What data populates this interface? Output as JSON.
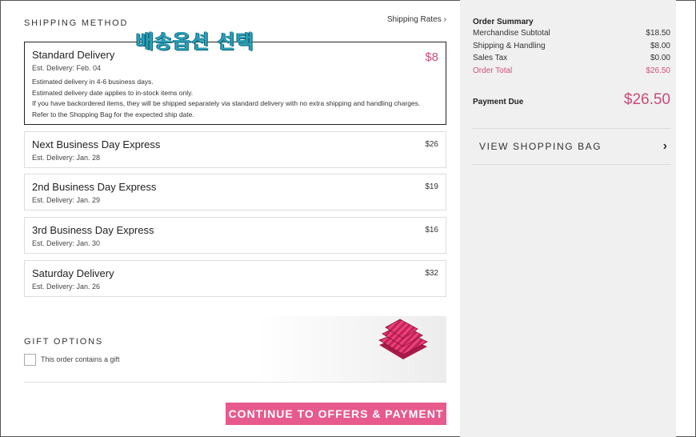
{
  "shipping": {
    "heading": "SHIPPING METHOD",
    "rates_link": "Shipping Rates",
    "overlay_korean": "배송옵션 선택",
    "options": [
      {
        "title": "Standard Delivery",
        "est": "Est. Delivery: Feb. 04",
        "price": "$8",
        "selected": true,
        "notes": [
          "Estimated delivery in 4-6 business days.",
          "Estimated delivery date applies to in-stock items only.",
          "If you have backordered items, they will be shipped separately via standard delivery with no extra shipping and handling charges. Refer to the Shopping Bag for the expected ship date."
        ]
      },
      {
        "title": "Next Business Day Express",
        "est": "Est. Delivery: Jan. 28",
        "price": "$26"
      },
      {
        "title": "2nd Business Day Express",
        "est": "Est. Delivery: Jan. 29",
        "price": "$19"
      },
      {
        "title": "3rd Business Day Express",
        "est": "Est. Delivery: Jan. 30",
        "price": "$16"
      },
      {
        "title": "Saturday Delivery",
        "est": "Est. Delivery: Jan. 26",
        "price": "$32"
      }
    ]
  },
  "gift": {
    "heading": "GIFT OPTIONS",
    "checkbox_label": "This order contains a gift",
    "checked": false
  },
  "continue_button": "CONTINUE TO OFFERS & PAYMENT",
  "summary": {
    "title": "Order Summary",
    "rows": [
      {
        "label": "Merchandise Subtotal",
        "value": "$18.50"
      },
      {
        "label": "Shipping & Handling",
        "value": "$8.00"
      },
      {
        "label": "Sales Tax",
        "value": "$0.00"
      },
      {
        "label": "Order Total",
        "value": "$26.50"
      }
    ],
    "payment_due_label": "Payment Due",
    "payment_due_value": "$26.50",
    "view_bag": "VIEW SHOPPING BAG"
  },
  "colors": {
    "accent_pink": "#e75a8d",
    "price_pink": "#d0517a",
    "overlay_teal": "#2aa0b8"
  }
}
